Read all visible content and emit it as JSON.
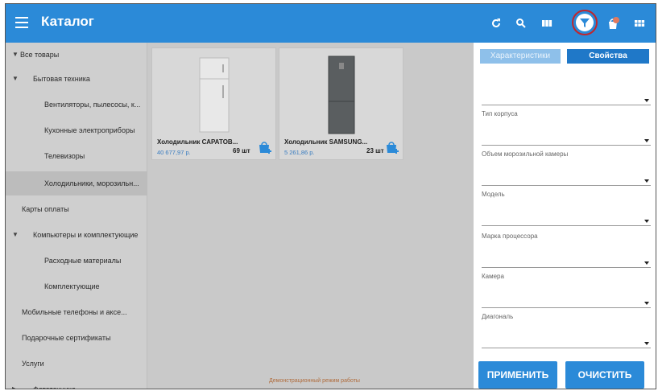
{
  "header": {
    "title": "Каталог",
    "icons": [
      "menu-icon",
      "refresh-icon",
      "search-icon",
      "view-toggle-icon",
      "filter-icon",
      "bag-icon",
      "grid-icon"
    ]
  },
  "sidebar": {
    "items": [
      {
        "label": "Все товары",
        "arrow": "▼"
      },
      {
        "label": "Бытовая техника",
        "arrow": "▼"
      },
      {
        "label": "Вентиляторы, пылесосы, к...",
        "arrow": ""
      },
      {
        "label": "Кухонные электроприборы",
        "arrow": ""
      },
      {
        "label": "Телевизоры",
        "arrow": ""
      },
      {
        "label": "Холодильники, морозильн...",
        "arrow": ""
      },
      {
        "label": "Карты оплаты",
        "arrow": ""
      },
      {
        "label": "Компьютеры и комплектующие",
        "arrow": "▼"
      },
      {
        "label": "Расходные материалы",
        "arrow": ""
      },
      {
        "label": "Комплектующие",
        "arrow": ""
      },
      {
        "label": "Мобильные телефоны и аксе...",
        "arrow": ""
      },
      {
        "label": "Подарочные сертификаты",
        "arrow": ""
      },
      {
        "label": "Услуги",
        "arrow": ""
      },
      {
        "label": "Фототехника",
        "arrow": "▶"
      }
    ]
  },
  "products": [
    {
      "name": "Холодильник САРАТОВ...",
      "price": "40 677,97 р.",
      "qty": "69 шт"
    },
    {
      "name": "Холодильник SAMSUNG...",
      "price": "5 261,86 р.",
      "qty": "23 шт"
    }
  ],
  "demo_note": "Демонстрационный режим работы",
  "filter_panel": {
    "tabs": {
      "characteristics": "Характеристики",
      "properties": "Свойства"
    },
    "fields": [
      {
        "label": ""
      },
      {
        "label": "Тип корпуса"
      },
      {
        "label": "Объем морозильной камеры"
      },
      {
        "label": "Модель"
      },
      {
        "label": "Марка процессора"
      },
      {
        "label": "Камера"
      },
      {
        "label": "Диагональ"
      }
    ],
    "apply_label": "ПРИМЕНИТЬ",
    "clear_label": "ОЧИСТИТЬ"
  },
  "colors": {
    "accent": "#2b8ad8",
    "highlight_ring": "#c0262d",
    "price": "#3a7dc0"
  }
}
